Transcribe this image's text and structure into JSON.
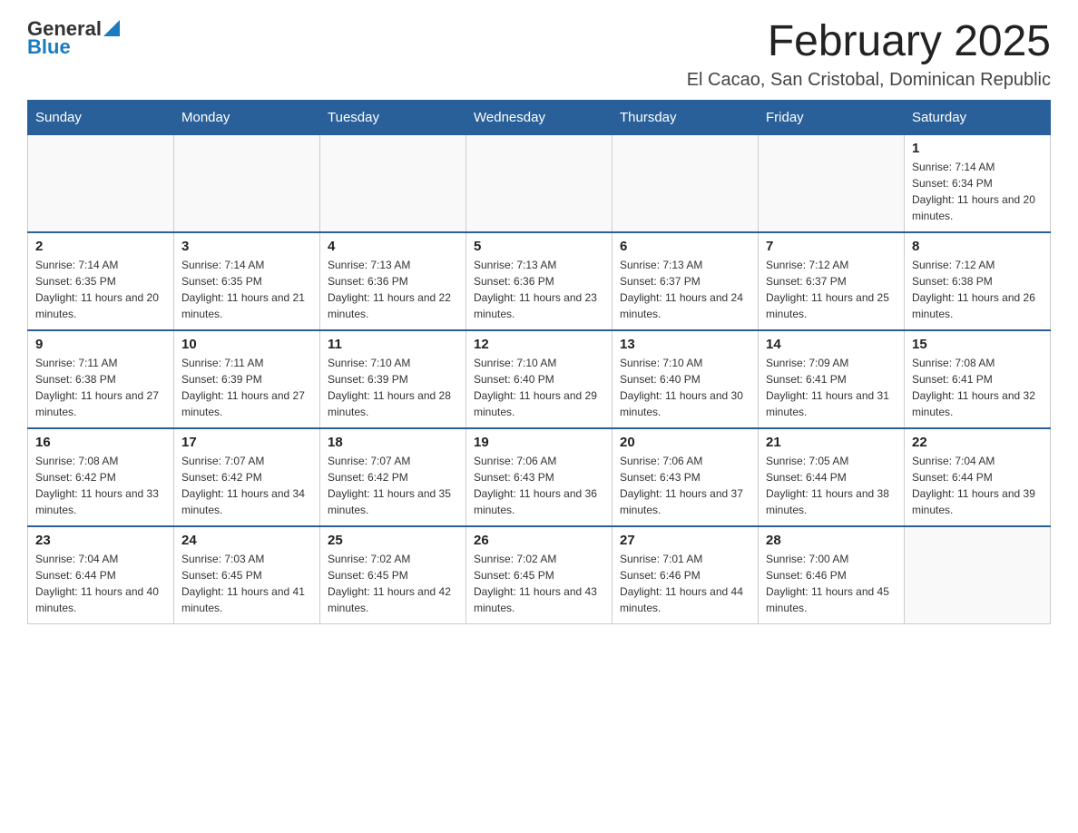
{
  "logo": {
    "general": "General",
    "blue": "Blue"
  },
  "title": "February 2025",
  "location": "El Cacao, San Cristobal, Dominican Republic",
  "headers": [
    "Sunday",
    "Monday",
    "Tuesday",
    "Wednesday",
    "Thursday",
    "Friday",
    "Saturday"
  ],
  "weeks": [
    [
      {
        "day": "",
        "info": ""
      },
      {
        "day": "",
        "info": ""
      },
      {
        "day": "",
        "info": ""
      },
      {
        "day": "",
        "info": ""
      },
      {
        "day": "",
        "info": ""
      },
      {
        "day": "",
        "info": ""
      },
      {
        "day": "1",
        "info": "Sunrise: 7:14 AM\nSunset: 6:34 PM\nDaylight: 11 hours and 20 minutes."
      }
    ],
    [
      {
        "day": "2",
        "info": "Sunrise: 7:14 AM\nSunset: 6:35 PM\nDaylight: 11 hours and 20 minutes."
      },
      {
        "day": "3",
        "info": "Sunrise: 7:14 AM\nSunset: 6:35 PM\nDaylight: 11 hours and 21 minutes."
      },
      {
        "day": "4",
        "info": "Sunrise: 7:13 AM\nSunset: 6:36 PM\nDaylight: 11 hours and 22 minutes."
      },
      {
        "day": "5",
        "info": "Sunrise: 7:13 AM\nSunset: 6:36 PM\nDaylight: 11 hours and 23 minutes."
      },
      {
        "day": "6",
        "info": "Sunrise: 7:13 AM\nSunset: 6:37 PM\nDaylight: 11 hours and 24 minutes."
      },
      {
        "day": "7",
        "info": "Sunrise: 7:12 AM\nSunset: 6:37 PM\nDaylight: 11 hours and 25 minutes."
      },
      {
        "day": "8",
        "info": "Sunrise: 7:12 AM\nSunset: 6:38 PM\nDaylight: 11 hours and 26 minutes."
      }
    ],
    [
      {
        "day": "9",
        "info": "Sunrise: 7:11 AM\nSunset: 6:38 PM\nDaylight: 11 hours and 27 minutes."
      },
      {
        "day": "10",
        "info": "Sunrise: 7:11 AM\nSunset: 6:39 PM\nDaylight: 11 hours and 27 minutes."
      },
      {
        "day": "11",
        "info": "Sunrise: 7:10 AM\nSunset: 6:39 PM\nDaylight: 11 hours and 28 minutes."
      },
      {
        "day": "12",
        "info": "Sunrise: 7:10 AM\nSunset: 6:40 PM\nDaylight: 11 hours and 29 minutes."
      },
      {
        "day": "13",
        "info": "Sunrise: 7:10 AM\nSunset: 6:40 PM\nDaylight: 11 hours and 30 minutes."
      },
      {
        "day": "14",
        "info": "Sunrise: 7:09 AM\nSunset: 6:41 PM\nDaylight: 11 hours and 31 minutes."
      },
      {
        "day": "15",
        "info": "Sunrise: 7:08 AM\nSunset: 6:41 PM\nDaylight: 11 hours and 32 minutes."
      }
    ],
    [
      {
        "day": "16",
        "info": "Sunrise: 7:08 AM\nSunset: 6:42 PM\nDaylight: 11 hours and 33 minutes."
      },
      {
        "day": "17",
        "info": "Sunrise: 7:07 AM\nSunset: 6:42 PM\nDaylight: 11 hours and 34 minutes."
      },
      {
        "day": "18",
        "info": "Sunrise: 7:07 AM\nSunset: 6:42 PM\nDaylight: 11 hours and 35 minutes."
      },
      {
        "day": "19",
        "info": "Sunrise: 7:06 AM\nSunset: 6:43 PM\nDaylight: 11 hours and 36 minutes."
      },
      {
        "day": "20",
        "info": "Sunrise: 7:06 AM\nSunset: 6:43 PM\nDaylight: 11 hours and 37 minutes."
      },
      {
        "day": "21",
        "info": "Sunrise: 7:05 AM\nSunset: 6:44 PM\nDaylight: 11 hours and 38 minutes."
      },
      {
        "day": "22",
        "info": "Sunrise: 7:04 AM\nSunset: 6:44 PM\nDaylight: 11 hours and 39 minutes."
      }
    ],
    [
      {
        "day": "23",
        "info": "Sunrise: 7:04 AM\nSunset: 6:44 PM\nDaylight: 11 hours and 40 minutes."
      },
      {
        "day": "24",
        "info": "Sunrise: 7:03 AM\nSunset: 6:45 PM\nDaylight: 11 hours and 41 minutes."
      },
      {
        "day": "25",
        "info": "Sunrise: 7:02 AM\nSunset: 6:45 PM\nDaylight: 11 hours and 42 minutes."
      },
      {
        "day": "26",
        "info": "Sunrise: 7:02 AM\nSunset: 6:45 PM\nDaylight: 11 hours and 43 minutes."
      },
      {
        "day": "27",
        "info": "Sunrise: 7:01 AM\nSunset: 6:46 PM\nDaylight: 11 hours and 44 minutes."
      },
      {
        "day": "28",
        "info": "Sunrise: 7:00 AM\nSunset: 6:46 PM\nDaylight: 11 hours and 45 minutes."
      },
      {
        "day": "",
        "info": ""
      }
    ]
  ]
}
